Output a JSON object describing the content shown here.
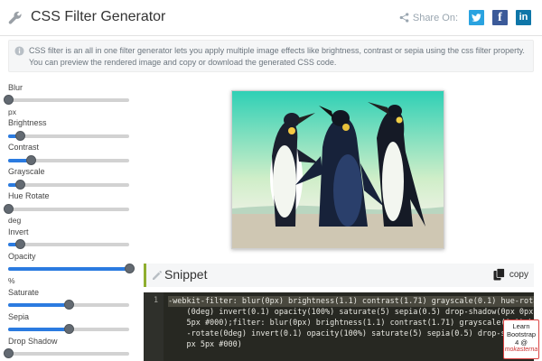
{
  "header": {
    "title": "CSS Filter Generator",
    "share_label": "Share On:",
    "icons": [
      "wrench-icon",
      "share-icon",
      "twitter-icon",
      "facebook-icon",
      "linkedin-icon"
    ]
  },
  "info": {
    "icon": "info-icon",
    "text": "CSS filter is an all in one filter generator lets you apply multiple image effects like brightness, contrast or sepia using the css filter property. You can preview the rendered image and copy or download the generated CSS code."
  },
  "controls": [
    {
      "label": "Blur",
      "unit": "px",
      "level": 0.0
    },
    {
      "label": "Brightness",
      "unit": "",
      "level": 0.1
    },
    {
      "label": "Contrast",
      "unit": "",
      "level": 0.19
    },
    {
      "label": "Grayscale",
      "unit": "",
      "level": 0.1
    },
    {
      "label": "Hue Rotate",
      "unit": "deg",
      "level": 0.0
    },
    {
      "label": "Invert",
      "unit": "",
      "level": 0.1
    },
    {
      "label": "Opacity",
      "unit": "%",
      "level": 1.0
    },
    {
      "label": "Saturate",
      "unit": "",
      "level": 0.5
    },
    {
      "label": "Sepia",
      "unit": "",
      "level": 0.5
    },
    {
      "label": "Drop Shadow",
      "unit": "",
      "level": 0.0
    }
  ],
  "snippet": {
    "title": "Snippet",
    "copy_label": "copy",
    "line_number": "1",
    "code_lines": [
      "-webkit-filter: blur(0px) brightness(1.1) contrast(1.71) grayscale(0.1) hue-rotate",
      "    (0deg) invert(0.1) opacity(100%) saturate(5) sepia(0.5) drop-shadow(0px 0px",
      "    5px #000);filter: blur(0px) brightness(1.1) contrast(1.71) grayscale(0.1) hue",
      "    -rotate(0deg) invert(0.1) opacity(100%) saturate(5) sepia(0.5) drop-shadow(0px 0",
      "    px 5px #000)"
    ]
  },
  "ad": {
    "text": "Learn Bootstrap 4 @",
    "brand": "mokasterna"
  },
  "colors": {
    "accent_blue": "#2b7be0",
    "twitter": "#2aa3e0",
    "facebook": "#3b5a99",
    "linkedin": "#0e76a8",
    "snippet_border": "#8fae2f",
    "code_bg": "#272822"
  }
}
